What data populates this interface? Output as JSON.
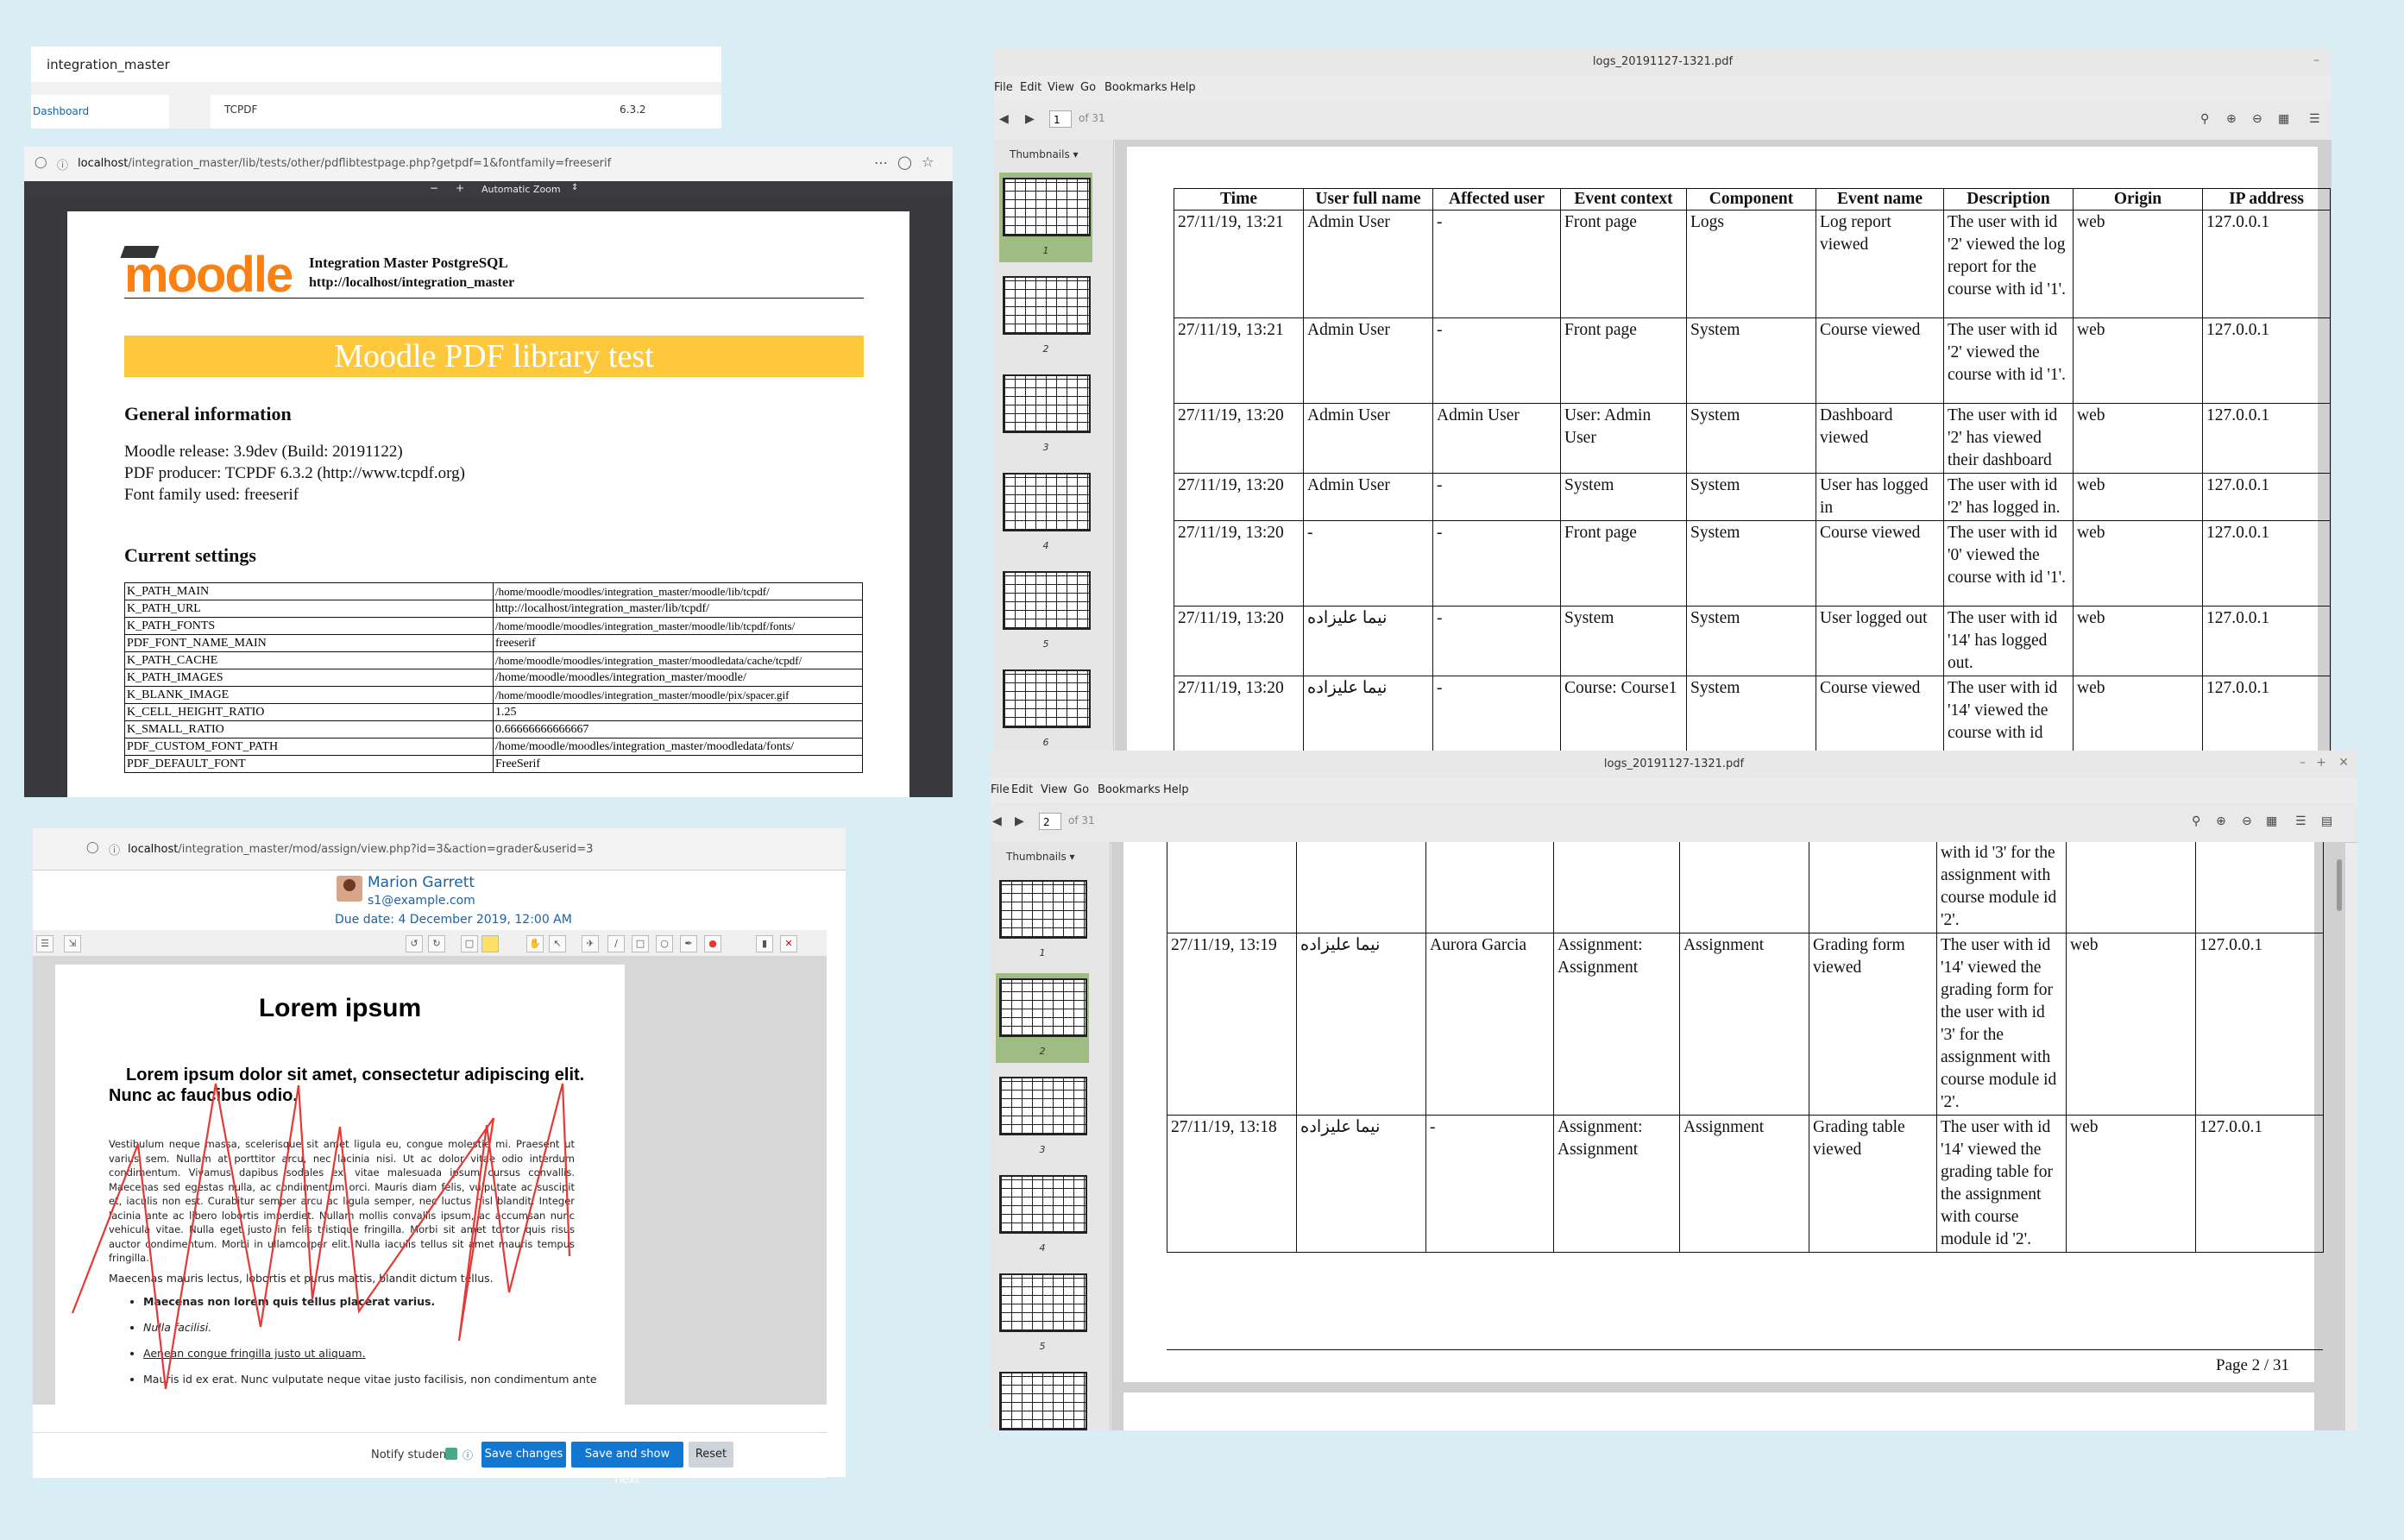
{
  "moodle_top": {
    "title": "integration_master",
    "dashboard": "Dashboard",
    "lib_name": "TCPDF",
    "lib_version": "6.3.2"
  },
  "pdf_test_window": {
    "url_host": "localhost",
    "url_path": "/integration_master/lib/tests/other/pdflibtestpage.php?getpdf=1&fontfamily=freeserif",
    "zoom_label": "Automatic Zoom",
    "logo_text": "moodle",
    "site_name": "Integration Master PostgreSQL",
    "site_url": "http://localhost/integration_master",
    "banner": "Moodle PDF library test",
    "general_heading": "General information",
    "general_lines": [
      "Moodle release: 3.9dev (Build: 20191122)",
      "PDF producer: TCPDF 6.3.2 (http://www.tcpdf.org)",
      "Font family used: freeserif"
    ],
    "settings_heading": "Current settings",
    "settings": [
      [
        "K_PATH_MAIN",
        "/home/moodle/moodles/integration_master/moodle/lib/tcpdf/"
      ],
      [
        "K_PATH_URL",
        "http://localhost/integration_master/lib/tcpdf/"
      ],
      [
        "K_PATH_FONTS",
        "/home/moodle/moodles/integration_master/moodle/lib/tcpdf/fonts/"
      ],
      [
        "PDF_FONT_NAME_MAIN",
        "freeserif"
      ],
      [
        "K_PATH_CACHE",
        "/home/moodle/moodles/integration_master/moodledata/cache/tcpdf/"
      ],
      [
        "K_PATH_IMAGES",
        "/home/moodle/moodles/integration_master/moodle/"
      ],
      [
        "K_BLANK_IMAGE",
        "/home/moodle/moodles/integration_master/moodle/pix/spacer.gif"
      ],
      [
        "K_CELL_HEIGHT_RATIO",
        "1.25"
      ],
      [
        "K_SMALL_RATIO",
        "0.66666666666667"
      ],
      [
        "PDF_CUSTOM_FONT_PATH",
        "/home/moodle/moodles/integration_master/moodledata/fonts/"
      ],
      [
        "PDF_DEFAULT_FONT",
        "FreeSerif"
      ]
    ]
  },
  "grader": {
    "url_host": "localhost",
    "url_path": "/integration_master/mod/assign/view.php?id=3&action=grader&userid=3",
    "user_name": "Marion Garrett",
    "user_email": "s1@example.com",
    "due_date": "Due date: 4 December 2019, 12:00 AM",
    "doc_title": "Lorem ipsum",
    "doc_lead": "Lorem ipsum dolor sit amet, consectetur adipiscing elit. Nunc ac faucibus odio.",
    "doc_para": "Vestibulum neque massa, scelerisque sit amet ligula eu, congue molestie mi. Praesent ut varius sem. Nullam at porttitor arcu, nec lacinia nisi. Ut ac dolor vitae odio interdum condimentum. Vivamus dapibus sodales ex, vitae malesuada ipsum cursus convallis. Maecenas sed egestas nulla, ac condimentum orci. Mauris diam felis, vulputate ac suscipit et, iaculis non est. Curabitur semper arcu ac ligula semper, nec luctus nisl blandit. Integer lacinia ante ac libero lobortis imperdiet. Nullam mollis convallis ipsum, ac accumsan nunc vehicula vitae. Nulla eget justo in felis tristique fringilla. Morbi sit amet tortor quis risus auctor condimentum. Morbi in ullamcorper elit. Nulla iaculis tellus sit amet mauris tempus fringilla.",
    "doc_para2": "Maecenas mauris lectus, lobortis et purus mattis, blandit dictum tellus.",
    "bullets": [
      "Maecenas non lorem quis tellus placerat varius.",
      "Nulla facilisi.",
      "Aenean congue fringilla justo ut aliquam.",
      "Mauris id ex erat. Nunc vulputate neque vitae justo facilisis, non condimentum ante"
    ],
    "notify_label": "Notify students",
    "save_changes": "Save changes",
    "save_next": "Save and show next",
    "reset": "Reset",
    "annotation_color": "#e53935"
  },
  "evince_common": {
    "filename": "logs_20191127-1321.pdf",
    "menu": [
      "File",
      "Edit",
      "View",
      "Go",
      "Bookmarks",
      "Help"
    ],
    "of_pages": "of 31",
    "sidebar_mode": "Thumbnails",
    "thumb_selected_color": "#9fbc84"
  },
  "evince1": {
    "page_number": "1",
    "thumb_numbers": [
      "1",
      "2",
      "3",
      "4",
      "5",
      "6"
    ],
    "headers": [
      "Time",
      "User full name",
      "Affected user",
      "Event context",
      "Component",
      "Event name",
      "Description",
      "Origin",
      "IP address"
    ],
    "rows": [
      [
        "27/11/19, 13:21",
        "Admin User",
        "-",
        "Front page",
        "Logs",
        "Log report viewed",
        "The user with id '2' viewed the log report for the course with id '1'.",
        "web",
        "127.0.0.1"
      ],
      [
        "27/11/19, 13:21",
        "Admin User",
        "-",
        "Front page",
        "System",
        "Course viewed",
        "The user with id '2' viewed the course with id '1'.",
        "web",
        "127.0.0.1"
      ],
      [
        "27/11/19, 13:20",
        "Admin User",
        "Admin User",
        "User: Admin User",
        "System",
        "Dashboard viewed",
        "The user with id '2' has viewed their dashboard",
        "web",
        "127.0.0.1"
      ],
      [
        "27/11/19, 13:20",
        "Admin User",
        "-",
        "System",
        "System",
        "User has logged in",
        "The user with id '2' has logged in.",
        "web",
        "127.0.0.1"
      ],
      [
        "27/11/19, 13:20",
        "-",
        "-",
        "Front page",
        "System",
        "Course viewed",
        "The user with id '0' viewed the course with id '1'.",
        "web",
        "127.0.0.1"
      ],
      [
        "27/11/19, 13:20",
        "نيما عليزاده",
        "-",
        "System",
        "System",
        "User logged out",
        "The user with id '14' has logged out.",
        "web",
        "127.0.0.1"
      ],
      [
        "27/11/19, 13:20",
        "نيما عليزاده",
        "-",
        "Course: Course1",
        "System",
        "Course viewed",
        "The user with id '14' viewed the course with id",
        "web",
        "127.0.0.1"
      ]
    ]
  },
  "evince2": {
    "page_number": "2",
    "thumb_numbers": [
      "1",
      "2",
      "3",
      "4",
      "5",
      ""
    ],
    "cont_description": "with id '3' for the assignment with course module id '2'.",
    "rows": [
      [
        "27/11/19, 13:19",
        "نيما عليزاده",
        "Aurora Garcia",
        "Assignment: Assignment",
        "Assignment",
        "Grading form viewed",
        "The user with id '14' viewed the grading form for the user with id '3' for the assignment with course module id '2'.",
        "web",
        "127.0.0.1"
      ],
      [
        "27/11/19, 13:18",
        "نيما عليزاده",
        "-",
        "Assignment: Assignment",
        "Assignment",
        "Grading table viewed",
        "The user with id '14' viewed the grading table for the assignment with course module id '2'.",
        "web",
        "127.0.0.1"
      ]
    ],
    "footer": "Page 2 / 31"
  }
}
